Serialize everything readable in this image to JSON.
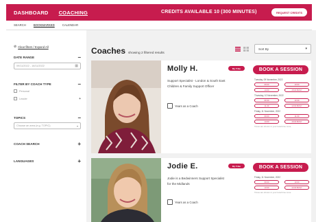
{
  "topbar": {
    "dashboard": "DASHBOARD",
    "coaching": "COACHING",
    "credits": "CREDITS AVAILABLE 10 (300 MINUTES)",
    "request": "REQUEST CREDITS"
  },
  "subnav": [
    "SEARCH",
    "BOOKMARKED",
    "CALENDAR"
  ],
  "sidebar": {
    "clear": "Clear filters / Expand All",
    "date_range_title": "DATE RANGE",
    "date_range_value": "09/11/2022 - 16/11/2022",
    "coach_type_title": "FILTER BY COACH TYPE",
    "coach_types": [
      "Personal",
      "Leader"
    ],
    "topics_title": "TOPICS",
    "topics_placeholder": "Choose an area (e.g. TOPIC)",
    "coach_search_title": "COACH SEARCH",
    "languages_title": "LANGUAGES"
  },
  "main": {
    "heading": "Coaches",
    "subheading": "showing 2 filtered results",
    "sort_label": "Sort By"
  },
  "coaches": [
    {
      "name": "Molly H.",
      "badge": "My Tribe",
      "description": "Support Specialist - London & South East Children & Family Support Officer",
      "years": "Years as a Coach",
      "book": "BOOK A SESSION",
      "slot_days": [
        {
          "date": "Tuesday, 09 November, 2022",
          "times": [
            "09:00",
            "10:00",
            "14:00",
            "15:00 BUSY"
          ]
        },
        {
          "date": "Thursday, 10 November, 2022",
          "times": [
            "09:30",
            "10:30",
            "11:30",
            "13:00 BUSY"
          ]
        },
        {
          "date": "Friday, 11 November, 2022",
          "times": [
            "09:00",
            "11:00",
            "14:00",
            "16:00 BUSY"
          ]
        }
      ],
      "note": "Times are shown in your local time zone"
    },
    {
      "name": "Jodie E.",
      "badge": "My Tribe",
      "description": "Jodie is a Bedwinners Support Specialist for the Midlands",
      "years": "Years as a Coach",
      "book": "BOOK A SESSION",
      "slot_days": [
        {
          "date": "Friday, 11 November, 2022",
          "times": [
            "09:00",
            "10:00",
            "13:00",
            "14:00 BUSY"
          ]
        }
      ],
      "note": "Times are shown in your local time zone"
    }
  ],
  "colors": {
    "brand": "#c71c4e",
    "panel": "#f1f1f1"
  }
}
